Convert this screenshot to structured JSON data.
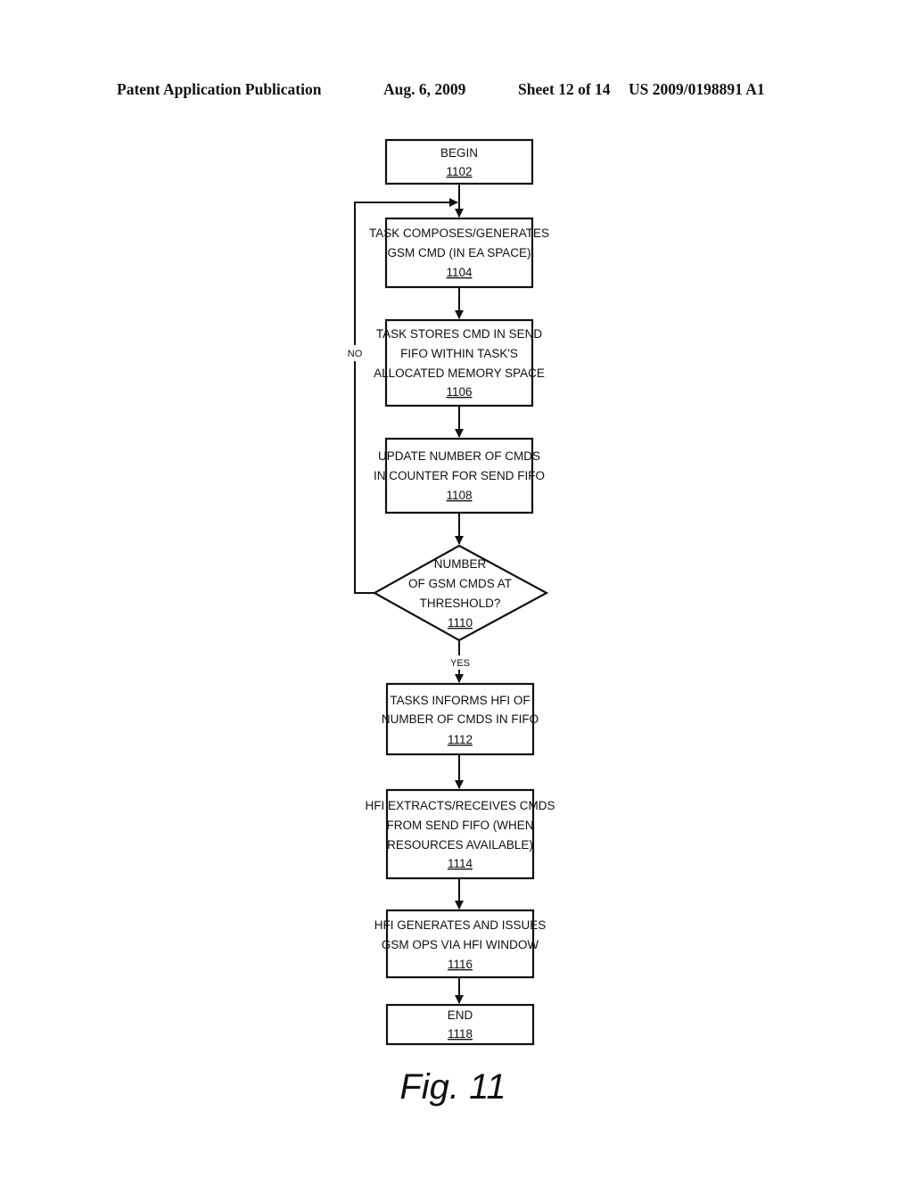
{
  "header": {
    "publication": "Patent Application Publication",
    "date": "Aug. 6, 2009",
    "sheet": "Sheet 12 of 14",
    "number": "US 2009/0198891 A1"
  },
  "flowchart": {
    "nodes": [
      {
        "id": "1102",
        "type": "terminal",
        "lines": [
          "BEGIN"
        ],
        "ref": "1102"
      },
      {
        "id": "1104",
        "type": "process",
        "lines": [
          "TASK COMPOSES/GENERATES",
          "GSM CMD (IN EA SPACE)"
        ],
        "ref": "1104"
      },
      {
        "id": "1106",
        "type": "process",
        "lines": [
          "TASK STORES CMD IN SEND",
          "FIFO WITHIN TASK'S",
          "ALLOCATED MEMORY SPACE"
        ],
        "ref": "1106"
      },
      {
        "id": "1108",
        "type": "process",
        "lines": [
          "UPDATE NUMBER OF CMDS",
          "IN COUNTER FOR SEND FIFO"
        ],
        "ref": "1108"
      },
      {
        "id": "1110",
        "type": "decision",
        "lines": [
          "NUMBER",
          "OF GSM CMDS AT",
          "THRESHOLD?"
        ],
        "ref": "1110"
      },
      {
        "id": "1112",
        "type": "process",
        "lines": [
          "TASKS INFORMS HFI OF",
          "NUMBER OF CMDS IN FIFO"
        ],
        "ref": "1112"
      },
      {
        "id": "1114",
        "type": "process",
        "lines": [
          "HFI EXTRACTS/RECEIVES CMDS",
          "FROM SEND FIFO (WHEN",
          "RESOURCES AVAILABLE)"
        ],
        "ref": "1114"
      },
      {
        "id": "1116",
        "type": "process",
        "lines": [
          "HFI GENERATES AND ISSUES",
          "GSM OPS VIA HFI WINDOW"
        ],
        "ref": "1116"
      },
      {
        "id": "1118",
        "type": "terminal",
        "lines": [
          "END"
        ],
        "ref": "1118"
      }
    ],
    "edge_labels": {
      "no": "NO",
      "yes": "YES"
    }
  },
  "figure_label": "Fig. 11"
}
